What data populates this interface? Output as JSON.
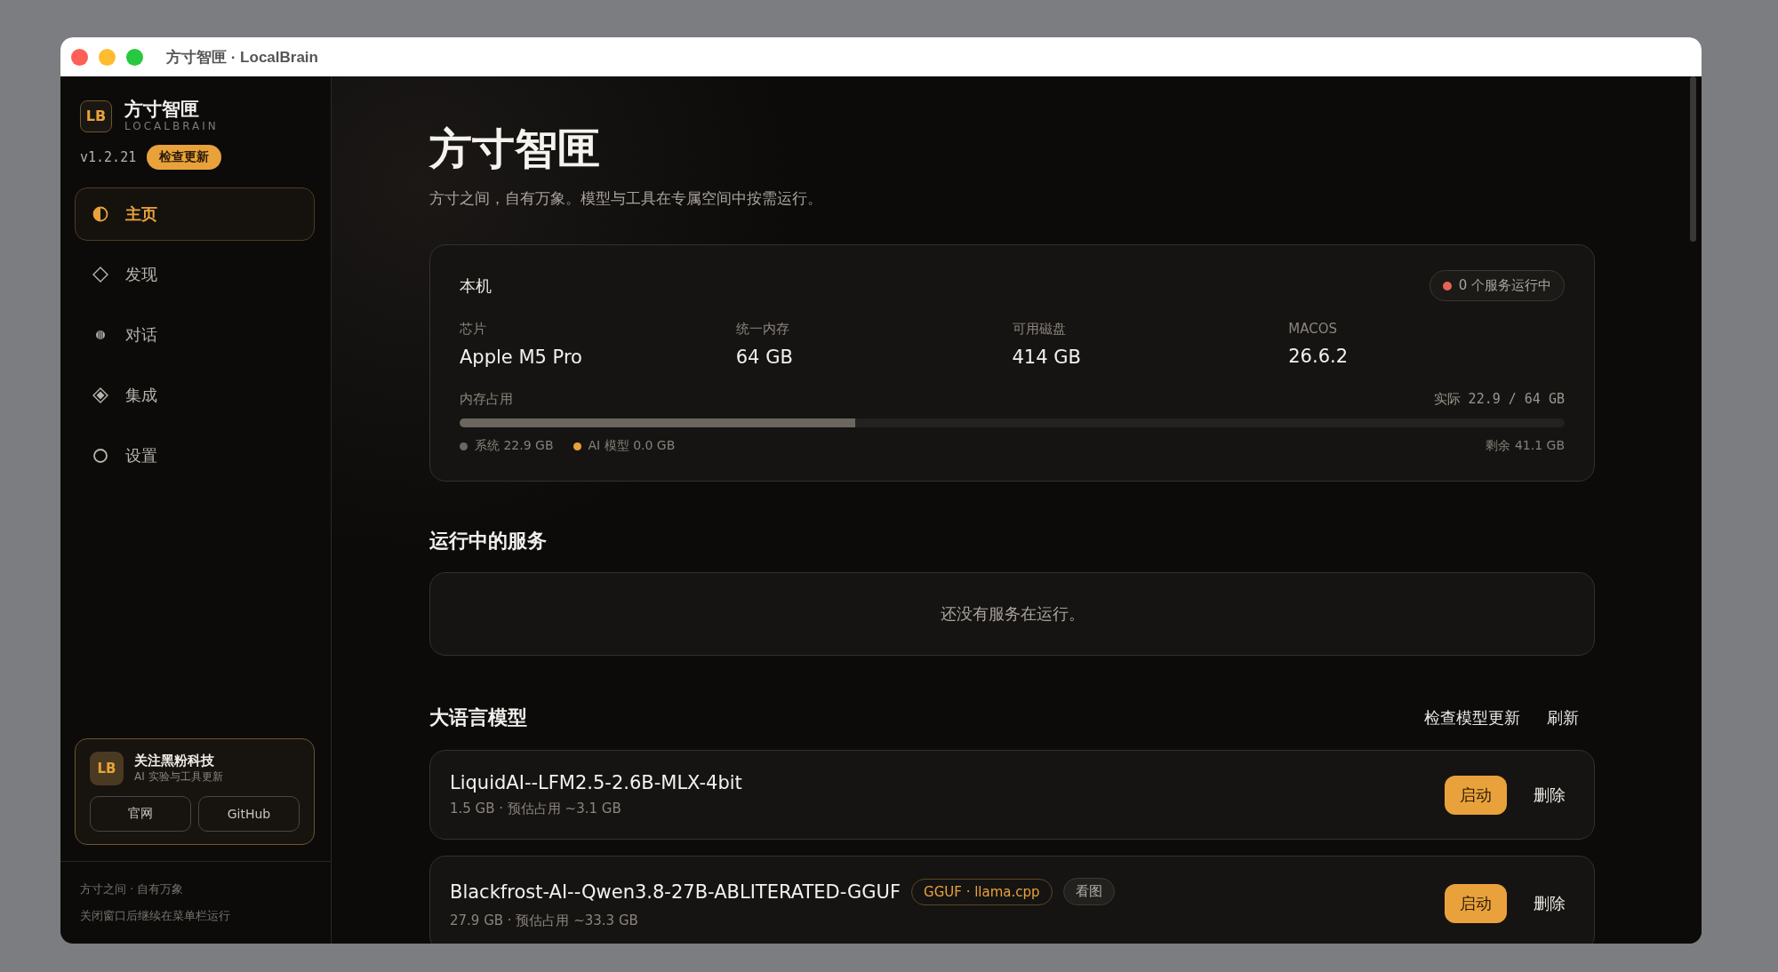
{
  "window": {
    "title": "方寸智匣 · LocalBrain"
  },
  "sidebar": {
    "logo": "LB",
    "app_name": "方寸智匣",
    "app_subname": "LOCALBRAIN",
    "version": "v1.2.21",
    "update_button": "检查更新",
    "items": [
      {
        "label": "主页",
        "selected": true
      },
      {
        "label": "发现",
        "selected": false
      },
      {
        "label": "对话",
        "selected": false
      },
      {
        "label": "集成",
        "selected": false
      },
      {
        "label": "设置",
        "selected": false
      }
    ],
    "promo": {
      "logo": "LB",
      "title": "关注黑粉科技",
      "subtitle": "AI 实验与工具更新",
      "buttons": [
        "官网",
        "GitHub"
      ]
    },
    "footer": [
      "方寸之间 · 自有万象",
      "关闭窗口后继续在菜单栏运行"
    ]
  },
  "header": {
    "title": "方寸智匣",
    "subtitle": "方寸之间，自有万象。模型与工具在专属空间中按需运行。"
  },
  "machine": {
    "title": "本机",
    "status": {
      "text": "0 个服务运行中",
      "color": "#e8625a"
    },
    "specs": [
      {
        "label": "芯片",
        "value": "Apple M5 Pro"
      },
      {
        "label": "统一内存",
        "value": "64 GB"
      },
      {
        "label": "可用磁盘",
        "value": "414 GB"
      },
      {
        "label": "MACOS",
        "value": "26.6.2"
      }
    ],
    "memory": {
      "label": "内存占用",
      "reading": "实际 22.9 / 64 GB",
      "level": 0.358,
      "legend": [
        {
          "text": "系统 22.9 GB",
          "color": "#6b675e"
        },
        {
          "text": "AI 模型 0.0 GB",
          "color": "#e9a23b"
        }
      ],
      "remaining": "剩余 41.1 GB"
    }
  },
  "services": {
    "title": "运行中的服务",
    "empty": "还没有服务在运行。"
  },
  "models": {
    "title": "大语言模型",
    "actions": [
      "检查模型更新",
      "刷新"
    ],
    "items": [
      {
        "name": "LiquidAI--LFM2.5-2.6B-MLX-4bit",
        "meta": "1.5 GB · 预估占用 ~3.1 GB",
        "start": "启动",
        "delete": "删除"
      },
      {
        "name": "Blackfrost-AI--Qwen3.8-27B-ABLITERATED-GGUF",
        "meta": "27.9 GB · 预估占用 ~33.3 GB",
        "tags": [
          {
            "text": "GGUF · llama.cpp",
            "kind": "format"
          },
          {
            "text": "看图",
            "kind": "capability"
          }
        ],
        "start": "启动",
        "delete": "删除"
      }
    ]
  }
}
